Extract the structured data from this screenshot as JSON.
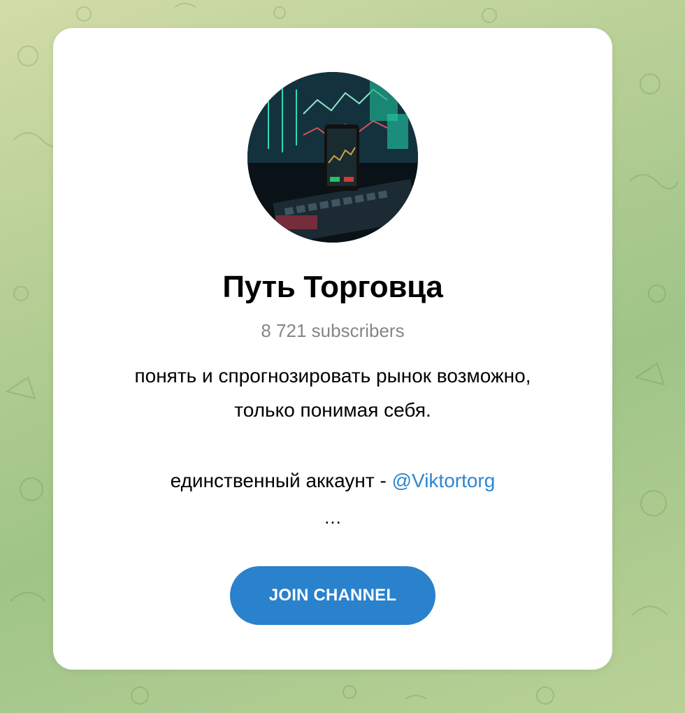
{
  "channel": {
    "title": "Путь Торговца",
    "subscribers": "8 721 subscribers",
    "description_line1": "понять и спрогнозировать рынок возможно,",
    "description_line2": "только понимая себя.",
    "account_prefix": "единственный аккаунт - ",
    "account_link": "@Viktortorg",
    "ellipsis": "…",
    "avatar_icon": "trading-setup-photo"
  },
  "actions": {
    "join_label": "JOIN CHANNEL"
  },
  "colors": {
    "accent": "#2a81cc",
    "link": "#2e86d0",
    "muted": "#868686",
    "background_green": "#a8c98e"
  }
}
